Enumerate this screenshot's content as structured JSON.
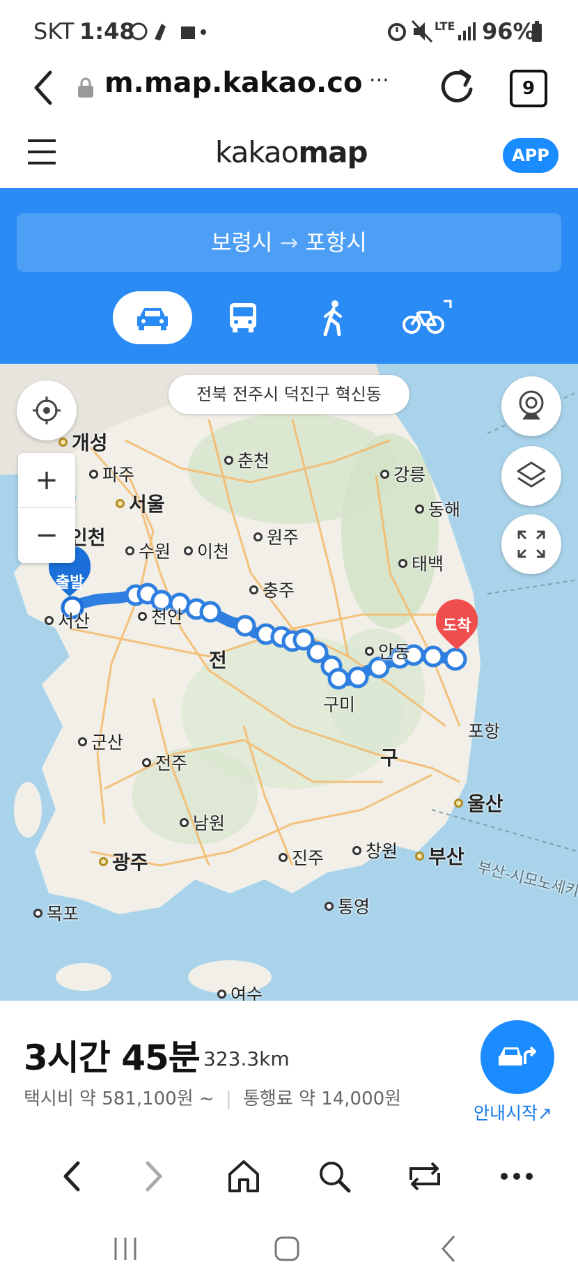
{
  "status_bar": {
    "carrier": "SKT",
    "time": "1:48",
    "network": "LTE",
    "battery": "96%"
  },
  "browser": {
    "url": "m.map.kakao.co",
    "tab_count": "9",
    "more": "···"
  },
  "header": {
    "logo_light": "kakao",
    "logo_bold": "map",
    "app_button": "APP"
  },
  "route": {
    "origin": "보령시",
    "arrow": "→",
    "destination": "포항시",
    "modes": [
      "car",
      "bus",
      "walk",
      "bike"
    ],
    "active_mode": "car"
  },
  "map": {
    "address_pill": "전북 전주시 덕진구 혁신동",
    "start_marker": "출발",
    "end_marker": "도착",
    "zoom_in": "+",
    "zoom_out": "−",
    "cities": {
      "gaeseong": "개성",
      "paju": "파주",
      "seoul": "서울",
      "incheon": "인천",
      "suwon": "수원",
      "icheon": "이천",
      "chuncheon": "춘천",
      "gangneung": "강릉",
      "donghae": "동해",
      "wonju": "원주",
      "taebaek": "태백",
      "chungju": "충주",
      "seosan": "서산",
      "cheonan": "천안",
      "andong": "안동",
      "daejeon_partial": "전",
      "gumi": "구미",
      "pohang": "포항",
      "gunsan": "군산",
      "jeonju": "전주",
      "daegu_partial": "구",
      "ulsan": "울산",
      "namwon": "남원",
      "gwangju": "광주",
      "jinju": "진주",
      "changwon": "창원",
      "busan": "부산",
      "mokpo": "목포",
      "tongyeong": "통영",
      "yeosu": "여수",
      "ferry": "부산-시모노세키"
    }
  },
  "summary": {
    "duration": "3시간 45분",
    "distance": "323.3km",
    "taxi_fee": "택시비 약 581,100원 ~",
    "toll": "통행료 약 14,000원",
    "start_nav": "안내시작↗"
  },
  "colors": {
    "brand_blue": "#2b8bf4",
    "route_line": "#2f7fe0",
    "start_pin": "#1a6fd8",
    "end_pin": "#f04d4d"
  }
}
